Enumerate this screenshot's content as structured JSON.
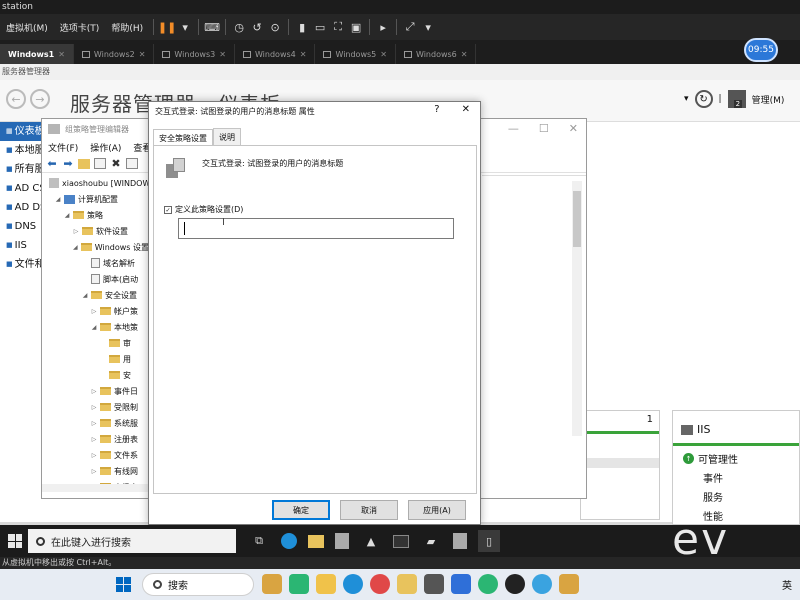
{
  "vm": {
    "title_fragment": "station",
    "menus": [
      "虚拟机(M)",
      "选项卡(T)",
      "帮助(H)"
    ],
    "tabs": [
      {
        "label": "Windows1",
        "active": true
      },
      {
        "label": "Windows2",
        "active": false
      },
      {
        "label": "Windows3",
        "active": false
      },
      {
        "label": "Windows4",
        "active": false
      },
      {
        "label": "Windows5",
        "active": false
      },
      {
        "label": "Windows6",
        "active": false
      }
    ],
    "clock": "09:55",
    "status_hint": "从虚拟机中移出或按 Ctrl+Alt。"
  },
  "server_manager": {
    "window_caption": "服务器管理器",
    "title": "服务器管理器 · 仪表板",
    "manage_label": "管理(M)",
    "notification_count": "2",
    "sidebar": [
      {
        "label": "仪表板",
        "active": true
      },
      {
        "label": "本地服务",
        "active": false
      },
      {
        "label": "所有服务",
        "active": false
      },
      {
        "label": "AD CS",
        "active": false
      },
      {
        "label": "AD DS",
        "active": false
      },
      {
        "label": "DNS",
        "active": false
      },
      {
        "label": "IIS",
        "active": false
      },
      {
        "label": "文件和存",
        "active": false
      }
    ],
    "tile_count": "1",
    "iis_tile": {
      "title": "IIS",
      "rows": [
        "可管理性",
        "事件",
        "服务",
        "性能"
      ]
    }
  },
  "gpm_editor": {
    "title": "组策略管理编辑器",
    "menus": [
      "文件(F)",
      "操作(A)",
      "查看(V)"
    ],
    "tree": [
      {
        "label": "xiaoshoubu [WINDOWS",
        "indent": 0,
        "icon": "policy",
        "tw": ""
      },
      {
        "label": "计算机配置",
        "indent": 1,
        "icon": "pc",
        "tw": "◢"
      },
      {
        "label": "策略",
        "indent": 2,
        "icon": "folder",
        "tw": "◢"
      },
      {
        "label": "软件设置",
        "indent": 3,
        "icon": "folder",
        "tw": "▷"
      },
      {
        "label": "Windows 设置",
        "indent": 3,
        "icon": "folder",
        "tw": "◢"
      },
      {
        "label": "域名解析",
        "indent": 4,
        "icon": "doc",
        "tw": ""
      },
      {
        "label": "脚本(启动",
        "indent": 4,
        "icon": "doc",
        "tw": ""
      },
      {
        "label": "安全设置",
        "indent": 4,
        "icon": "folder",
        "tw": "◢"
      },
      {
        "label": "帐户策",
        "indent": 5,
        "icon": "folder",
        "tw": "▷"
      },
      {
        "label": "本地策",
        "indent": 5,
        "icon": "folder",
        "tw": "◢"
      },
      {
        "label": "审",
        "indent": 6,
        "icon": "folder",
        "tw": ""
      },
      {
        "label": "用",
        "indent": 6,
        "icon": "folder",
        "tw": ""
      },
      {
        "label": "安",
        "indent": 6,
        "icon": "folder",
        "tw": ""
      },
      {
        "label": "事件日",
        "indent": 5,
        "icon": "folder",
        "tw": "▷"
      },
      {
        "label": "受限制",
        "indent": 5,
        "icon": "folder",
        "tw": "▷"
      },
      {
        "label": "系统服",
        "indent": 5,
        "icon": "folder",
        "tw": "▷"
      },
      {
        "label": "注册表",
        "indent": 5,
        "icon": "folder",
        "tw": "▷"
      },
      {
        "label": "文件系",
        "indent": 5,
        "icon": "folder",
        "tw": "▷"
      },
      {
        "label": "有线网",
        "indent": 5,
        "icon": "folder",
        "tw": "▷"
      },
      {
        "label": "高级安",
        "indent": 5,
        "icon": "folder",
        "tw": "▷"
      },
      {
        "label": "网络列",
        "indent": 5,
        "icon": "folder",
        "tw": ""
      },
      {
        "label": "无线网",
        "indent": 5,
        "icon": "folder",
        "tw": "▷"
      },
      {
        "label": "公钥策",
        "indent": 5,
        "icon": "folder",
        "tw": "▷"
      },
      {
        "label": "软件限",
        "indent": 5,
        "icon": "folder",
        "tw": "▷"
      }
    ]
  },
  "dialog": {
    "title": "交互式登录: 试图登录的用户的消息标题 属性",
    "help_glyph": "?",
    "close_glyph": "✕",
    "tabs": [
      "安全策略设置",
      "说明"
    ],
    "policy_name": "交互式登录: 试图登录的用户的消息标题",
    "define_label": "定义此策略设置(D)",
    "define_checked": true,
    "input_value": "",
    "buttons": {
      "ok": "确定",
      "cancel": "取消",
      "apply": "应用(A)"
    }
  },
  "guest_taskbar": {
    "search_placeholder": "在此键入进行搜索"
  },
  "watermark": "ev",
  "host_taskbar": {
    "search_placeholder": "搜索",
    "ime": "英"
  }
}
